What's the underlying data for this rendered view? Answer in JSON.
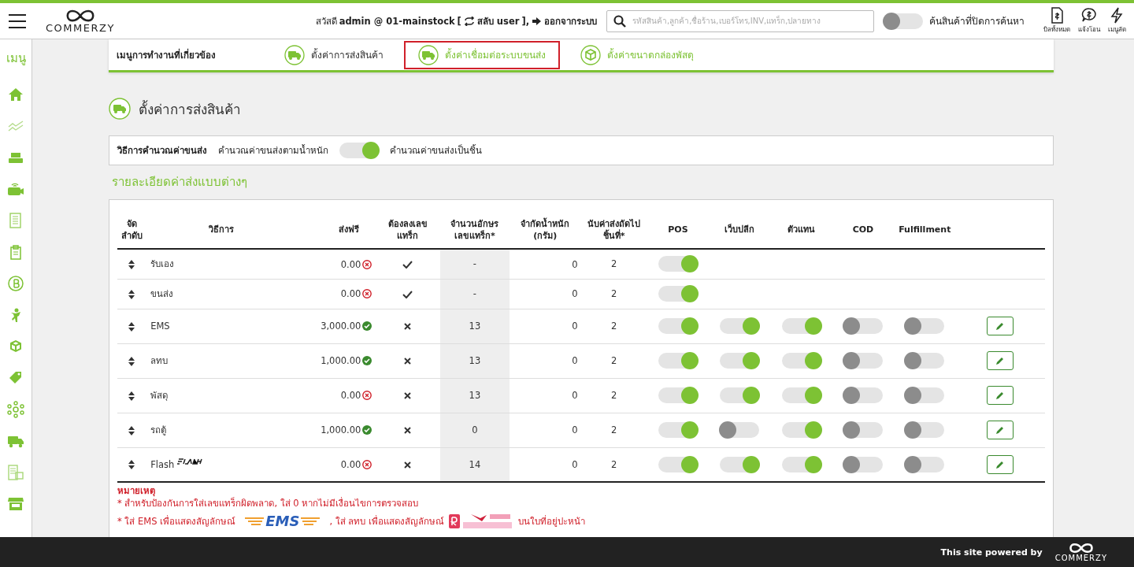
{
  "header": {
    "logo_text": "COMMERZY",
    "greeting": "สวัสดี",
    "user": "admin @ 01-mainstock",
    "switch_prefix": "[",
    "switch_user": "สลับ user",
    "switch_suffix": "],",
    "logout": "ออกจากระบบ",
    "search": {
      "placeholder": "รหัสสินค้า,ลูกค้า,ชื่อร้าน,เบอร์โทร,INV,แทร็ก,ปลายทาง"
    },
    "hidden_search": {
      "on": false,
      "label": "ค้นสินค้าที่ปิดการค้นหา"
    },
    "shortcuts": [
      {
        "kind": "bill",
        "label": "บิลทั้งหมด"
      },
      {
        "kind": "transfer",
        "label": "แจ้งโอน"
      },
      {
        "kind": "quick",
        "label": "เมนูลัด"
      }
    ]
  },
  "sidebar": {
    "label": "เมนู",
    "items": [
      {
        "kind": "home"
      },
      {
        "kind": "chart"
      },
      {
        "kind": "register"
      },
      {
        "kind": "camera"
      },
      {
        "kind": "docs"
      },
      {
        "kind": "clipboard"
      },
      {
        "kind": "baht"
      },
      {
        "kind": "person"
      },
      {
        "kind": "box"
      },
      {
        "kind": "tag"
      },
      {
        "kind": "network"
      },
      {
        "kind": "truck"
      },
      {
        "kind": "store-doc"
      },
      {
        "kind": "store"
      }
    ]
  },
  "related_menu": {
    "label": "เมนูการทำงานที่เกี่ยวข้อง",
    "items": [
      {
        "kind": "truck",
        "label": "ตั้งค่าการส่งสินค้า",
        "current": true,
        "selected": false
      },
      {
        "kind": "truck",
        "label": "ตั้งค่าเชื่อมต่อระบบขนส่ง",
        "current": false,
        "selected": true
      },
      {
        "kind": "box",
        "label": "ตั้งค่าขนาดกล่องพัสดุ",
        "current": false,
        "selected": false
      }
    ]
  },
  "page_title": "ตั้งค่าการส่งสินค้า",
  "calc_method": {
    "label": "วิธีการคำนวณค่าขนส่ง",
    "left_option": "คำนวณค่าขนส่งตามน้ำหนัก",
    "on": true,
    "right_option": "คำนวณค่าขนส่งเป็นชิ้น"
  },
  "section_title": "รายละเอียดค่าส่งแบบต่างๆ",
  "table": {
    "columns": [
      "จัด ลำดับ",
      "วิธีการ",
      "ส่งฟรี",
      "ต้องลงเลข แทร็ก",
      "จำนวนอักษร เลขแทร็ก*",
      "จำกัดน้ำหนัก (กรัม)",
      "นับค่าส่งถัดไป ชิ้นที่*",
      "POS",
      "เว็บปลีก",
      "ตัวแทน",
      "COD",
      "Fulfillment"
    ],
    "rows": [
      {
        "method": "รับเอง",
        "logo": false,
        "free": "0.00",
        "free_enabled": false,
        "tracking_required": true,
        "tracking_chars": "-",
        "weight_limit": "0",
        "next_item": "2",
        "toggles": [
          {
            "on": true
          }
        ],
        "editable": false
      },
      {
        "method": "ขนส่ง",
        "logo": false,
        "free": "0.00",
        "free_enabled": false,
        "tracking_required": true,
        "tracking_chars": "-",
        "weight_limit": "0",
        "next_item": "2",
        "toggles": [
          {
            "on": true
          }
        ],
        "editable": false
      },
      {
        "method": "EMS",
        "logo": false,
        "free": "3,000.00",
        "free_enabled": true,
        "tracking_required": false,
        "tracking_chars": "13",
        "weight_limit": "0",
        "next_item": "2",
        "toggles": [
          {
            "on": true
          },
          {
            "on": true
          },
          {
            "on": true
          },
          {
            "on": false
          },
          {
            "on": false
          }
        ],
        "editable": true
      },
      {
        "method": "ลทบ",
        "logo": false,
        "free": "1,000.00",
        "free_enabled": true,
        "tracking_required": false,
        "tracking_chars": "13",
        "weight_limit": "0",
        "next_item": "2",
        "toggles": [
          {
            "on": true
          },
          {
            "on": true
          },
          {
            "on": true
          },
          {
            "on": false
          },
          {
            "on": false
          }
        ],
        "editable": true
      },
      {
        "method": "พัสดุ",
        "logo": false,
        "free": "0.00",
        "free_enabled": false,
        "tracking_required": false,
        "tracking_chars": "13",
        "weight_limit": "0",
        "next_item": "2",
        "toggles": [
          {
            "on": true
          },
          {
            "on": true
          },
          {
            "on": true
          },
          {
            "on": false
          },
          {
            "on": false
          }
        ],
        "editable": true
      },
      {
        "method": "รถตู้",
        "logo": false,
        "free": "1,000.00",
        "free_enabled": true,
        "tracking_required": false,
        "tracking_chars": "0",
        "weight_limit": "0",
        "next_item": "2",
        "toggles": [
          {
            "on": true
          },
          {
            "on": false
          },
          {
            "on": true
          },
          {
            "on": false
          },
          {
            "on": false
          }
        ],
        "editable": true
      },
      {
        "method": "Flash",
        "logo": true,
        "free": "0.00",
        "free_enabled": false,
        "tracking_required": false,
        "tracking_chars": "14",
        "weight_limit": "0",
        "next_item": "2",
        "toggles": [
          {
            "on": true
          },
          {
            "on": true
          },
          {
            "on": true
          },
          {
            "on": false
          },
          {
            "on": false
          }
        ],
        "editable": true
      }
    ]
  },
  "notes": {
    "title": "หมายเหตุ",
    "line1": "* สำหรับป้องกันการใส่เลขแทร็กผิดพลาด, ใส่ 0 หากไม่มีเงื่อนไขการตรวจสอบ",
    "line2_a": "* ใส่ EMS เพื่อแสดงสัญลักษณ์",
    "ems_logo": "EMS",
    "line2_b": ", ใส่ ลทบ เพื่อแสดงสัญลักษณ์",
    "line2_c": "บนใบที่อยู่ปะหน้า"
  },
  "footer": {
    "text": "This site powered by",
    "logo_text": "COMMERZY"
  }
}
